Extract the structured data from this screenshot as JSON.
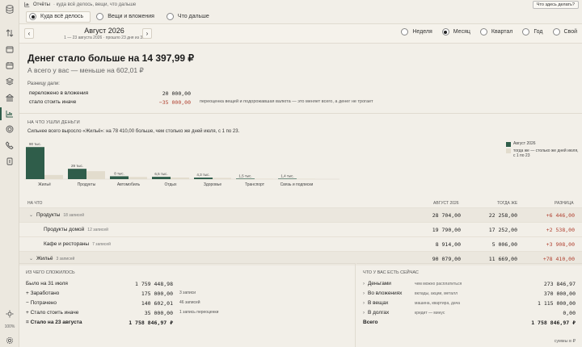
{
  "app": {
    "title": "Отчёты",
    "subtitle": "· куда всё делось, вещи, что дальше",
    "help_button": "Что здесь делать?"
  },
  "tabs": [
    {
      "label": "Куда всё делось",
      "selected": true
    },
    {
      "label": "Вещи и вложения",
      "selected": false
    },
    {
      "label": "Что дальше",
      "selected": false
    }
  ],
  "period": {
    "prev": "‹",
    "next": "›",
    "title": "Август 2026",
    "subtitle": "1 — 23 августа 2026 · прошло 23 дня из 31"
  },
  "ranges": [
    {
      "label": "Неделя",
      "selected": false
    },
    {
      "label": "Месяц",
      "selected": true
    },
    {
      "label": "Квартал",
      "selected": false
    },
    {
      "label": "Год",
      "selected": false
    },
    {
      "label": "Свой",
      "selected": false
    }
  ],
  "summary": {
    "headline": "Денег стало больше на 14 397,99 ₽",
    "sub": "А всего у вас — меньше на 602,01 ₽",
    "diff_label": "Разницу дали:",
    "rows": [
      {
        "label": "переложено в вложения",
        "value": "20 000,00",
        "note": ""
      },
      {
        "label": "стало стоить иначе",
        "value": "−35 000,00",
        "note": "переоценка вещей и подорожавшая валюта — это меняет всего, а денег не трогает"
      }
    ]
  },
  "spending": {
    "section_label": "НА ЧТО УШЛИ ДЕНЬГИ",
    "description": "Сильнее всего выросло «Жильё»: на 78 410,00 больше, чем столько же дней июля, с 1 по 23.",
    "legend": [
      {
        "label": "Август 2026",
        "color": "#2f5d4a"
      },
      {
        "label": "тогда же — столько же дней июля, с 1 по 23",
        "color": "#e2dccd"
      }
    ]
  },
  "chart_data": {
    "type": "bar",
    "categories": [
      "Жильё",
      "Продукты",
      "Автомобиль",
      "Отдых",
      "Здоровье",
      "Транспорт",
      "Связь и подписки"
    ],
    "value_labels": [
      "90 тыс.",
      "29 тыс.",
      "8 тыс.",
      "6,5 тыс.",
      "4,3 тыс.",
      "1,5 тыс.",
      "1,4 тыс."
    ],
    "series": [
      {
        "name": "Август 2026",
        "values": [
          90,
          29,
          8,
          6.5,
          4.3,
          1.5,
          1.4
        ],
        "color": "#2f5d4a"
      },
      {
        "name": "тогда же — столько же дней июля, с 1 по 23",
        "values": [
          11.7,
          22.3,
          6,
          4.5,
          3.5,
          1.2,
          1.0
        ],
        "color": "#e2dccd"
      }
    ],
    "ylim": [
      0,
      95
    ]
  },
  "table": {
    "headers": {
      "name": "НА ЧТО",
      "current": "АВГУСТ 2026",
      "previous": "ТОГДА ЖЕ",
      "diff": "РАЗНИЦА"
    },
    "rows": [
      {
        "name": "Продукты",
        "count": "18 записей",
        "current": "28 704,00",
        "previous": "22 258,00",
        "diff": "+6 446,00",
        "group": true,
        "chevron": "⌄"
      },
      {
        "name": "Продукты домой",
        "count": "12 записей",
        "current": "19 790,00",
        "previous": "17 252,00",
        "diff": "+2 538,00",
        "group": false
      },
      {
        "name": "Кафе и рестораны",
        "count": "7 записей",
        "current": "8 914,00",
        "previous": "5 006,00",
        "diff": "+3 908,00",
        "group": false
      },
      {
        "name": "Жильё",
        "count": "3 записей",
        "current": "90 079,00",
        "previous": "11 669,00",
        "diff": "+78 410,00",
        "group": true,
        "chevron": "⌄"
      }
    ]
  },
  "composition": {
    "label": "ИЗ ЧЕГО СЛОЖИЛОСЬ",
    "rows": [
      {
        "label": "Было на 31 июля",
        "value": "1 759 448,98",
        "note": "",
        "bold": false
      },
      {
        "label": "+ Заработано",
        "value": "175 000,00",
        "note": "3 записи",
        "bold": false
      },
      {
        "label": "− Потрачено",
        "value": "140 602,01",
        "note": "46 записей",
        "bold": false
      },
      {
        "label": "+ Стало стоить иначе",
        "value": "35 000,00",
        "note": "1 запись переоценки",
        "bold": false
      },
      {
        "label": "= Стало на 23 августа",
        "value": "1 758 846,97 ₽",
        "note": "",
        "bold": true
      }
    ]
  },
  "assets": {
    "label": "ЧТО У ВАС ЕСТЬ СЕЙЧАС",
    "rows": [
      {
        "label": "Деньгами",
        "note": "чем можно расплатиться",
        "value": "273 846,97"
      },
      {
        "label": "Во вложениях",
        "note": "вклады, акции, металл",
        "value": "370 000,00"
      },
      {
        "label": "В вещах",
        "note": "машина, квартира, дача",
        "value": "1 115 000,00"
      },
      {
        "label": "В долгах",
        "note": "кредит — минус",
        "value": "0,00"
      }
    ],
    "total_label": "Всего",
    "total_value": "1 758 846,97 ₽",
    "footer": "суммы в ₽"
  },
  "zoom": "100%"
}
